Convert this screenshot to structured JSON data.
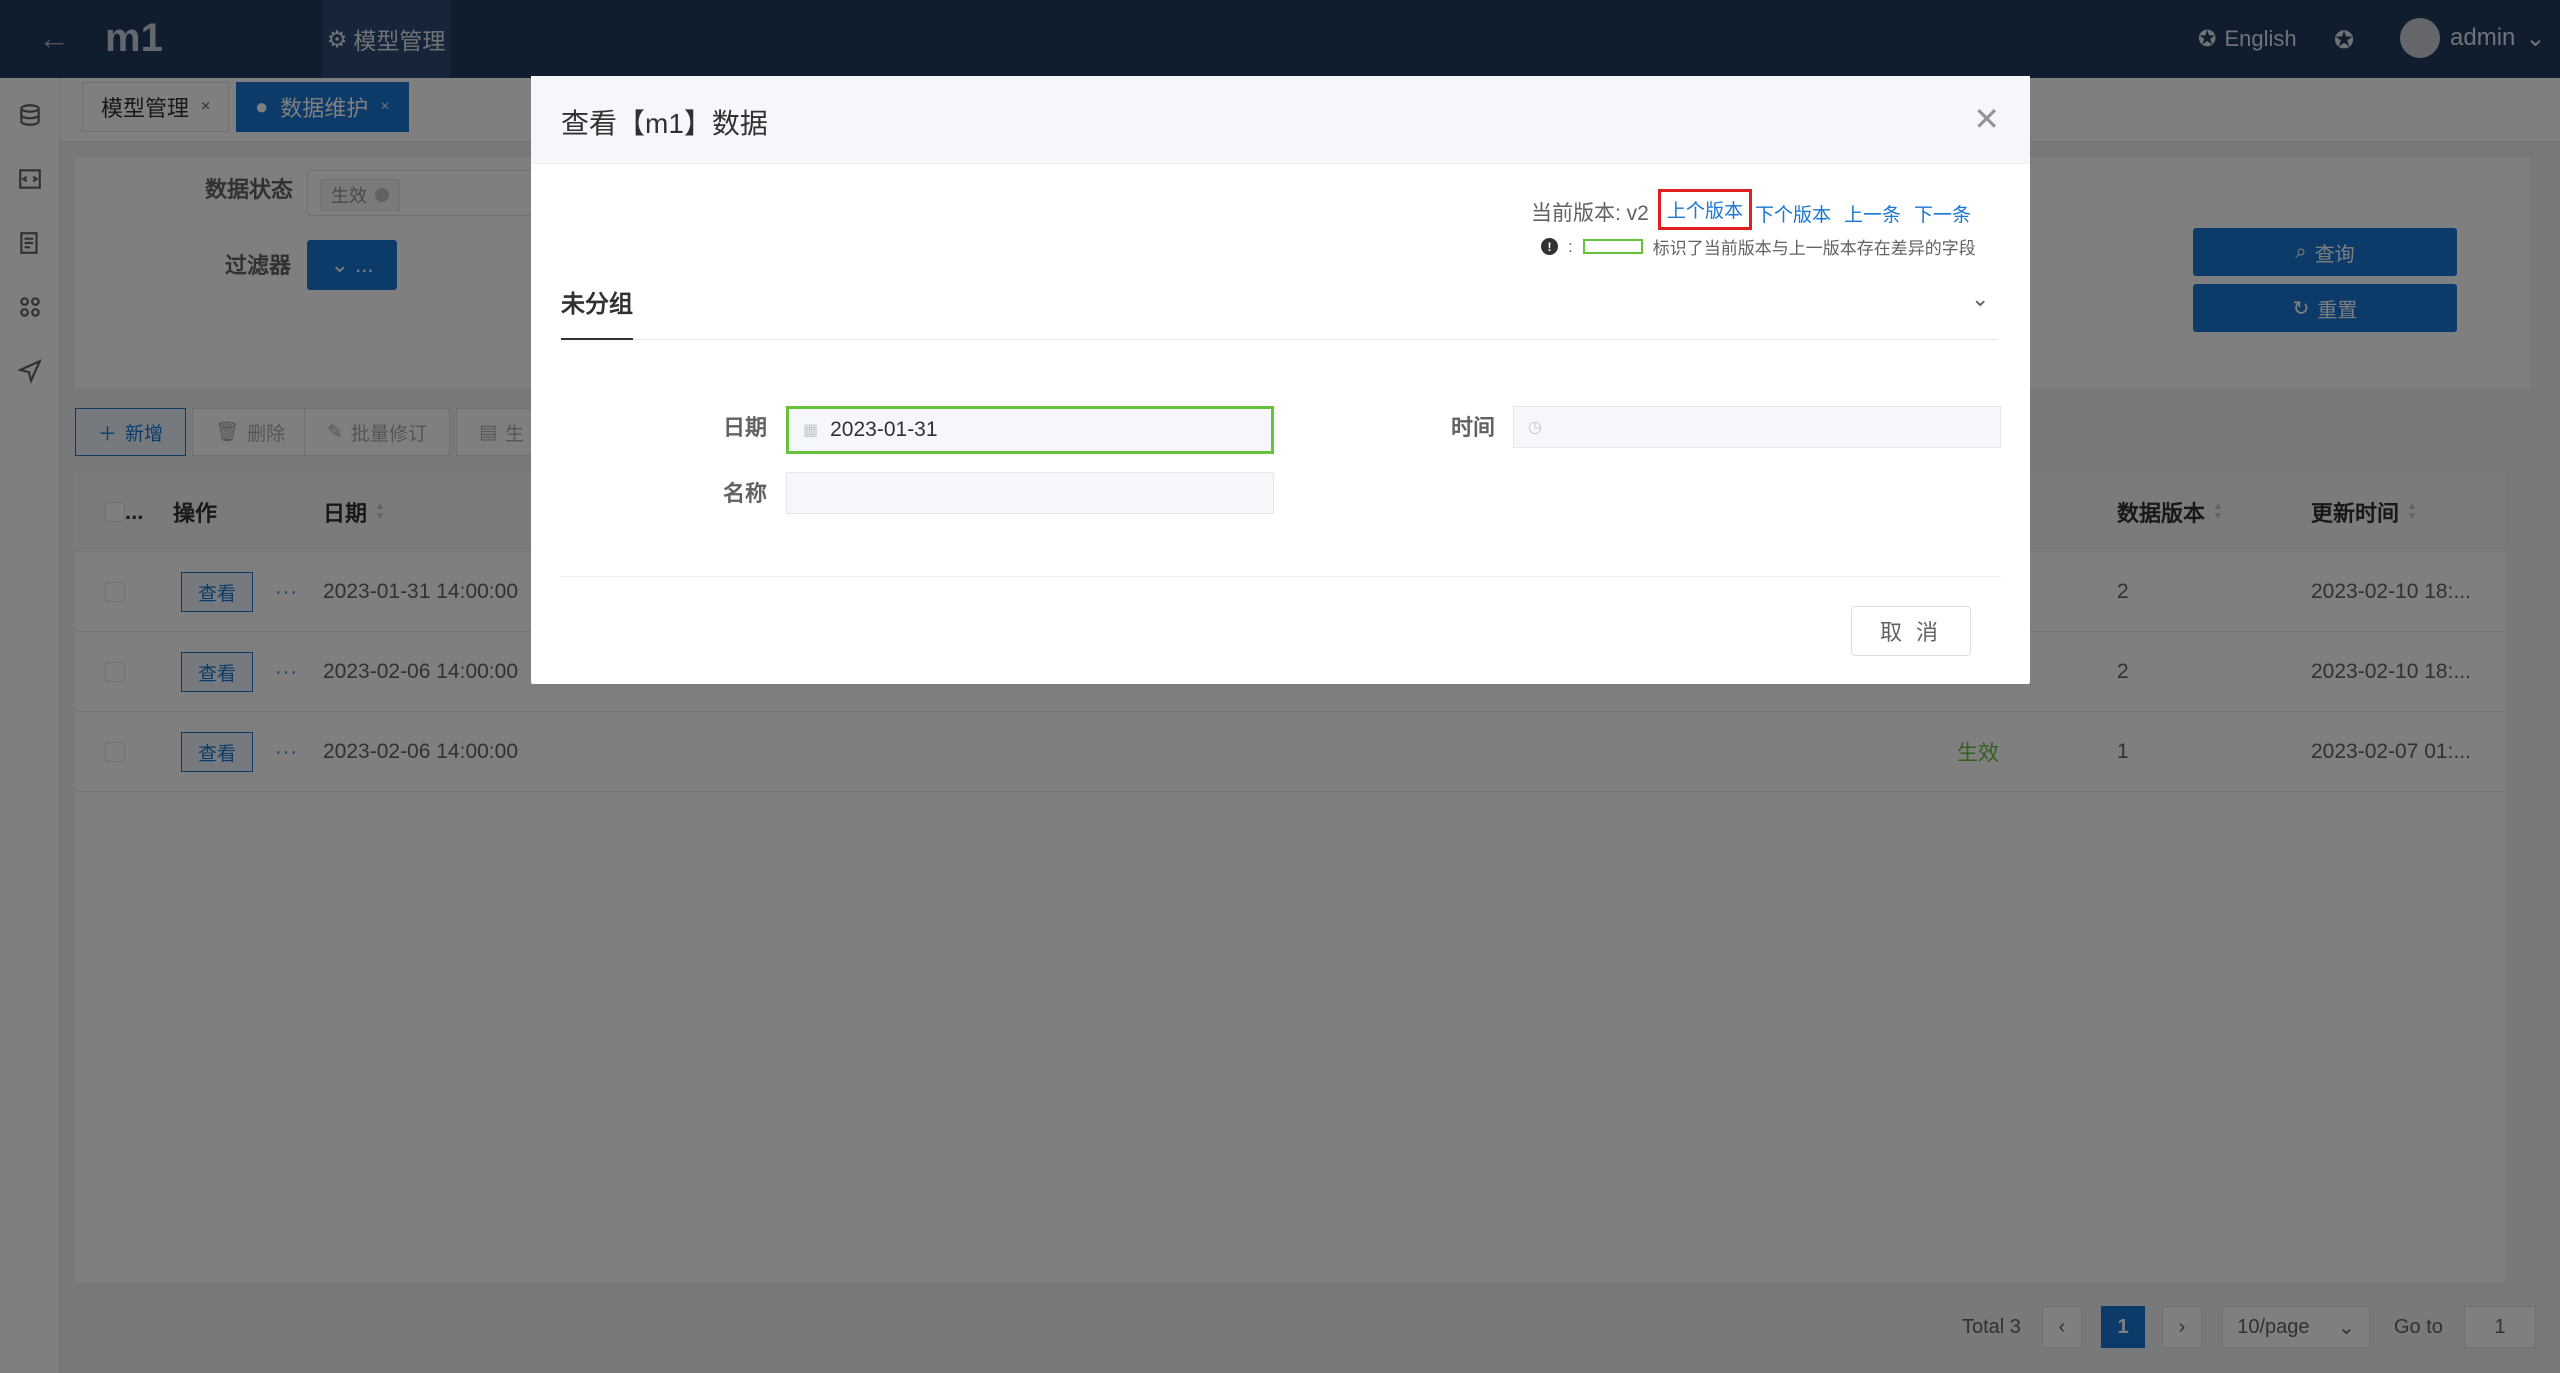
{
  "header": {
    "app_name": "m1",
    "menu_item": "模型管理",
    "language": "English",
    "user": "admin"
  },
  "tabs": [
    {
      "label": "模型管理",
      "active": false
    },
    {
      "label": "数据维护",
      "active": true
    }
  ],
  "filter": {
    "status_label": "数据状态",
    "status_tag": "生效",
    "filter_label": "过滤器",
    "filter_button": "...",
    "query_button": "查询",
    "reset_button": "重置"
  },
  "toolbar": {
    "add": "新增",
    "delete": "删除",
    "batch_edit": "批量修订",
    "partial": "生"
  },
  "table": {
    "columns": {
      "select": "...",
      "action": "操作",
      "date": "日期",
      "version": "数据版本",
      "updated": "更新时间"
    },
    "view_label": "查看",
    "more_label": "···",
    "rows": [
      {
        "date": "2023-01-31 14:00:00",
        "status": "",
        "version": "2",
        "updated": "2023-02-10 18:..."
      },
      {
        "date": "2023-02-06 14:00:00",
        "status": "",
        "version": "2",
        "updated": "2023-02-10 18:..."
      },
      {
        "date": "2023-02-06 14:00:00",
        "status": "生效",
        "version": "1",
        "updated": "2023-02-07 01:..."
      }
    ]
  },
  "pagination": {
    "total": "Total 3",
    "current_page": "1",
    "page_size": "10/page",
    "goto_label": "Go to",
    "goto_value": "1"
  },
  "dialog": {
    "title": "查看【m1】数据",
    "current_version": "当前版本: v2",
    "prev_version": "上个版本",
    "next_version": "下个版本",
    "prev_record": "上一条",
    "next_record": "下一条",
    "legend_text": "标识了当前版本与上一版本存在差异的字段",
    "group_title": "未分组",
    "fields": {
      "date_label": "日期",
      "date_value": "2023-01-31",
      "time_label": "时间",
      "time_value": "",
      "name_label": "名称",
      "name_value": ""
    },
    "cancel": "取 消"
  },
  "colors": {
    "header_bg": "#1f3a5f",
    "primary": "#1976d2",
    "diff_highlight": "#67c23a",
    "annotation": "#e02020"
  }
}
